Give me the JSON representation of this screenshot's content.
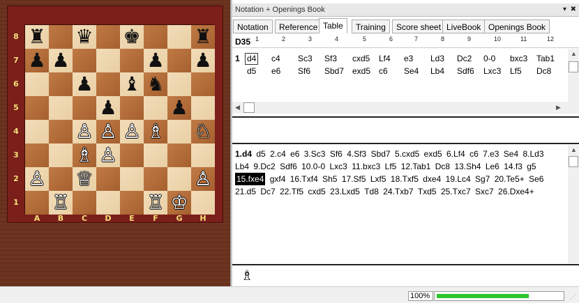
{
  "board": {
    "rank_labels": [
      "8",
      "7",
      "6",
      "5",
      "4",
      "3",
      "2",
      "1"
    ],
    "file_labels": [
      "A",
      "B",
      "C",
      "D",
      "E",
      "F",
      "G",
      "H"
    ],
    "squares": [
      [
        "♜",
        "",
        "♛",
        "",
        "♚",
        "",
        "",
        "♜"
      ],
      [
        "♟",
        "♟",
        "",
        "",
        "",
        "♟",
        "",
        "♟"
      ],
      [
        "",
        "",
        "♟",
        "",
        "♝",
        "♞",
        "",
        ""
      ],
      [
        "",
        "",
        "",
        "♟",
        "",
        "",
        "♟",
        ""
      ],
      [
        "",
        "",
        "♙",
        "♙",
        "♙",
        "♗",
        "",
        "♘"
      ],
      [
        "",
        "",
        "♗",
        "♙",
        "",
        "",
        "",
        ""
      ],
      [
        "♙",
        "",
        "♕",
        "",
        "",
        "",
        "",
        "♙"
      ],
      [
        "",
        "♖",
        "",
        "",
        "",
        "♖",
        "♔",
        ""
      ]
    ],
    "colors": [
      [
        "b",
        "",
        "b",
        "",
        "b",
        "",
        "",
        "b"
      ],
      [
        "b",
        "b",
        "",
        "",
        "",
        "b",
        "",
        "b"
      ],
      [
        "",
        "",
        "b",
        "",
        "b",
        "b",
        "",
        ""
      ],
      [
        "",
        "",
        "",
        "b",
        "",
        "",
        "b",
        ""
      ],
      [
        "",
        "",
        "w",
        "w",
        "w",
        "w",
        "",
        "w"
      ],
      [
        "",
        "",
        "w",
        "w",
        "",
        "",
        "",
        ""
      ],
      [
        "w",
        "",
        "w",
        "",
        "",
        "",
        "",
        "w"
      ],
      [
        "",
        "w",
        "",
        "",
        "",
        "w",
        "w",
        ""
      ]
    ]
  },
  "panel": {
    "title": "Notation + Openings Book",
    "pin_icon": "▾",
    "close_icon": "✖"
  },
  "tabs": [
    "Notation",
    "Reference",
    "Table",
    "Training",
    "Score sheet",
    "LiveBook",
    "Openings Book"
  ],
  "active_tab": "Table",
  "table": {
    "eco": "D35",
    "column_numbers": [
      "1",
      "2",
      "3",
      "4",
      "5",
      "6",
      "7",
      "8",
      "9",
      "10",
      "11",
      "12"
    ],
    "row_number": "1",
    "white_moves": [
      "d4",
      "c4",
      "Sc3",
      "Sf3",
      "cxd5",
      "Lf4",
      "e3",
      "Ld3",
      "Dc2",
      "0-0",
      "bxc3",
      "Tab1"
    ],
    "black_moves": [
      "d5",
      "e6",
      "Sf6",
      "Sbd7",
      "exd5",
      "c6",
      "Se4",
      "Lb4",
      "Sdf6",
      "Lxc3",
      "Lf5",
      "Dc8"
    ]
  },
  "notation": {
    "moves": [
      "1.d4",
      "d5",
      "2.c4",
      "e6",
      "3.Sc3",
      "Sf6",
      "4.Sf3",
      "Sbd7",
      "5.cxd5",
      "exd5",
      "6.Lf4",
      "c6",
      "7.e3",
      "Se4",
      "8.Ld3",
      "Lb4",
      "9.Dc2",
      "Sdf6",
      "10.0-0",
      "Lxc3",
      "11.bxc3",
      "Lf5",
      "12.Tab1",
      "Dc8",
      "13.Sh4",
      "Le6",
      "14.f3",
      "g5",
      "15.fxe4",
      "gxf4",
      "16.Txf4",
      "Sh5",
      "17.Sf5",
      "Lxf5",
      "18.Txf5",
      "dxe4",
      "19.Lc4",
      "Sg7",
      "20.Te5+",
      "Se6",
      "21.d5",
      "Dc7",
      "22.Tf5",
      "cxd5",
      "23.Lxd5",
      "Td8",
      "24.Txb7",
      "Txd5",
      "25.Txc7",
      "Sxc7",
      "26.Dxe4+"
    ],
    "current": "15.fxe4"
  },
  "bottom_pane": {
    "piece": "♗"
  },
  "status": {
    "zoom": "100%",
    "progress": 0.73
  }
}
